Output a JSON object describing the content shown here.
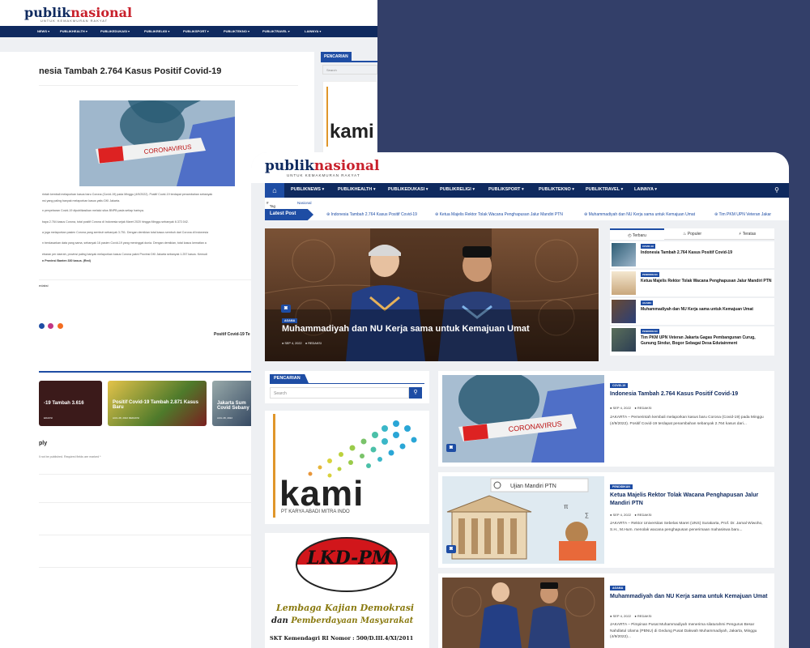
{
  "back": {
    "logo_a": "publik",
    "logo_b": "nasional",
    "tagline": "UNTUK KEMAKMURAN RAKYAT",
    "nav": [
      "NEWS ▾",
      "PUBLIKHEALTH ▾",
      "PUBLIKEDUKASI ▾",
      "PUBLIKRELIGI ▾",
      "PUBLIKSPORT ▾",
      "PUBLIKTEKNO ▾",
      "PUBLIKTRAVEL ▾",
      "LAINNYA ▾"
    ],
    "headline": "nesia Tambah 2.764 Kasus Positif Covid-19",
    "image_caption": "CORONAVIRUS",
    "paragraphs": [
      "rintah kembali melaporkan kasus baru Corona (Covid-19) pada Minggu (4/9/2022). Positif Covid-19 terdapat penambahan sebanyak",
      "nsi yang paling banyak melaporkan kasus yaitu DKI Jakarta.",
      "n penyebaran Covid-19 dipublikasikan melalui situs BNPB pada setiap harinya.",
      "baya 2.764 kasus Corona, total positif Corona di Indonesia sejak Maret 2020 hingga Minggu sebanyak 6.372.042.",
      "a juga melaporkan pasien Corona yang sembuh sebanyak 3.751. Dengan demikian total kasus sembuh dari Corona di Indonesia",
      "n berdasarkan data yang sama, sebanyak 16 pasien Covid-19 yang meninggal dunia. Dengan demikian, total kasus kematian a",
      "ebaran per daerah, provinsi paling banyak melaporkan kasus Corona yakni Provinsi DKI Jakarta sebanyak 1.257 kasus. Kemudi",
      "n Provinsi Banten 330 kasus. (Red)"
    ],
    "author": "edaksi",
    "sidebar_search_head": "PENCARIAN",
    "sidebar_search_placeholder": "Search",
    "next_post": "Positif Covid-19 Te",
    "related": [
      {
        "title": "-19 Tambah 3.616",
        "meta": "EDAKSI"
      },
      {
        "title": "Positif Covid-19 Tambah 2.871 Kasus Baru",
        "meta": "AUG 28, 2022   REDAKSI"
      },
      {
        "title": "Jakarta Sum Covid Sebany",
        "meta": "AUG 28, 2022"
      }
    ],
    "reply_title": "ply",
    "reply_note": "ll not be published. Required fields are marked *"
  },
  "front": {
    "logo_a": "publik",
    "logo_b": "nasional",
    "tagline": "UNTUK KEMAKMURAN RAKYAT",
    "nav": [
      "PUBLIKNEWS ▾",
      "PUBLIKHEALTH ▾",
      "PUBLIKEDUKASI ▾",
      "PUBLIKRELIGI ▾",
      "PUBLIKSPORT ▾",
      "PUBLIKTEKNO ▾",
      "PUBLIKTRAVEL ▾",
      "LAINNYA ▾"
    ],
    "tag_label": "Tag Teratas",
    "tag_value": "Nasional",
    "ticker_label": "Latest Post",
    "ticker": [
      "Indonesia Tambah 2.764 Kasus Positif Covid-19",
      "Ketua Majelis Rektor Tolak Wacana Penghapusan Jalur Mandiri PTN",
      "Muhammadiyah dan NU Kerja sama untuk Kemajuan Umat",
      "Tim PKM UPN Veteran Jakar"
    ],
    "hero": {
      "category": "AGAMA",
      "title": "Muhammadiyah dan NU Kerja sama untuk Kemajuan Umat",
      "date": "SEP 4, 2022",
      "author": "REDAKSI"
    },
    "tabs": [
      "Terbaru",
      "Populer",
      "Teratas"
    ],
    "tab_items": [
      {
        "category": "COVID-19",
        "title": "Indonesia Tambah 2.764 Kasus Positif Covid-19"
      },
      {
        "category": "PENDIDIKAN",
        "title": "Ketua Majelis Rektor Tolak Wacana Penghapusan Jalur Mandiri PTN"
      },
      {
        "category": "AGAMA",
        "title": "Muhammadiyah dan NU Kerja sama untuk Kemajuan Umat"
      },
      {
        "category": "PENDIDIKAN",
        "title": "Tim PKM UPN Veteran Jakarta Gagas Pembangunan Curug, Gunung Sindur, Bogor Sebagai Desa Edutainment"
      }
    ],
    "search_head": "PENCARIAN",
    "search_placeholder": "Search",
    "kami": {
      "word": "kami",
      "sub": "PT KARYA ABADI MITRA INDO"
    },
    "lkd": {
      "word": "LKD-PM",
      "line1": "Lembaga Kajian Demokrasi",
      "line2a": "dan",
      "line2b": "Pemberdayaan Masyarakat",
      "skt": "SKT Kemendagri RI Nomor : 500/D.III.4/XI/2011"
    },
    "posts": [
      {
        "category": "COVID-19",
        "title": "Indonesia Tambah 2.764 Kasus Positif Covid-19",
        "date": "SEP 4, 2022",
        "author": "REDAKSI",
        "excerpt": "JAKARTA – Pemerintah kembali melaporkan kasus baru Corona (Covid-19) pada Minggu (4/9/2022). Positif Covid-19 terdapat penambahan sebanyak 2.764 kasus dari...",
        "image_caption": "CORONAVIRUS"
      },
      {
        "category": "PENDIDIKAN",
        "title": "Ketua Majelis Rektor Tolak Wacana Penghapusan Jalur Mandiri PTN",
        "date": "SEP 4, 2022",
        "author": "REDAKSI",
        "excerpt": "JAKARTA – Rektor Universitas Sebelas Maret (UNS) Surakarta, Prof. Dr. Jamal Wiwoho, S.H., M.Hum. menolak wacana penghapusan penerimaan mahasiswa baru...",
        "image_caption": "Ujian Mandiri PTN"
      },
      {
        "category": "AGAMA",
        "title": "Muhammadiyah dan NU Kerja sama untuk Kemajuan Umat",
        "date": "SEP 4, 2022",
        "author": "REDAKSI",
        "excerpt": "JAKARTA – Pimpinan Pusat Muhammadiyah menerima silaturahmi Pengurus Besar Nahdlatul Ulama (PBNU) di Gedung Pusat Dakwah Muhammadiyah, Jakarta, Minggu (4/9/2022)..."
      }
    ]
  }
}
